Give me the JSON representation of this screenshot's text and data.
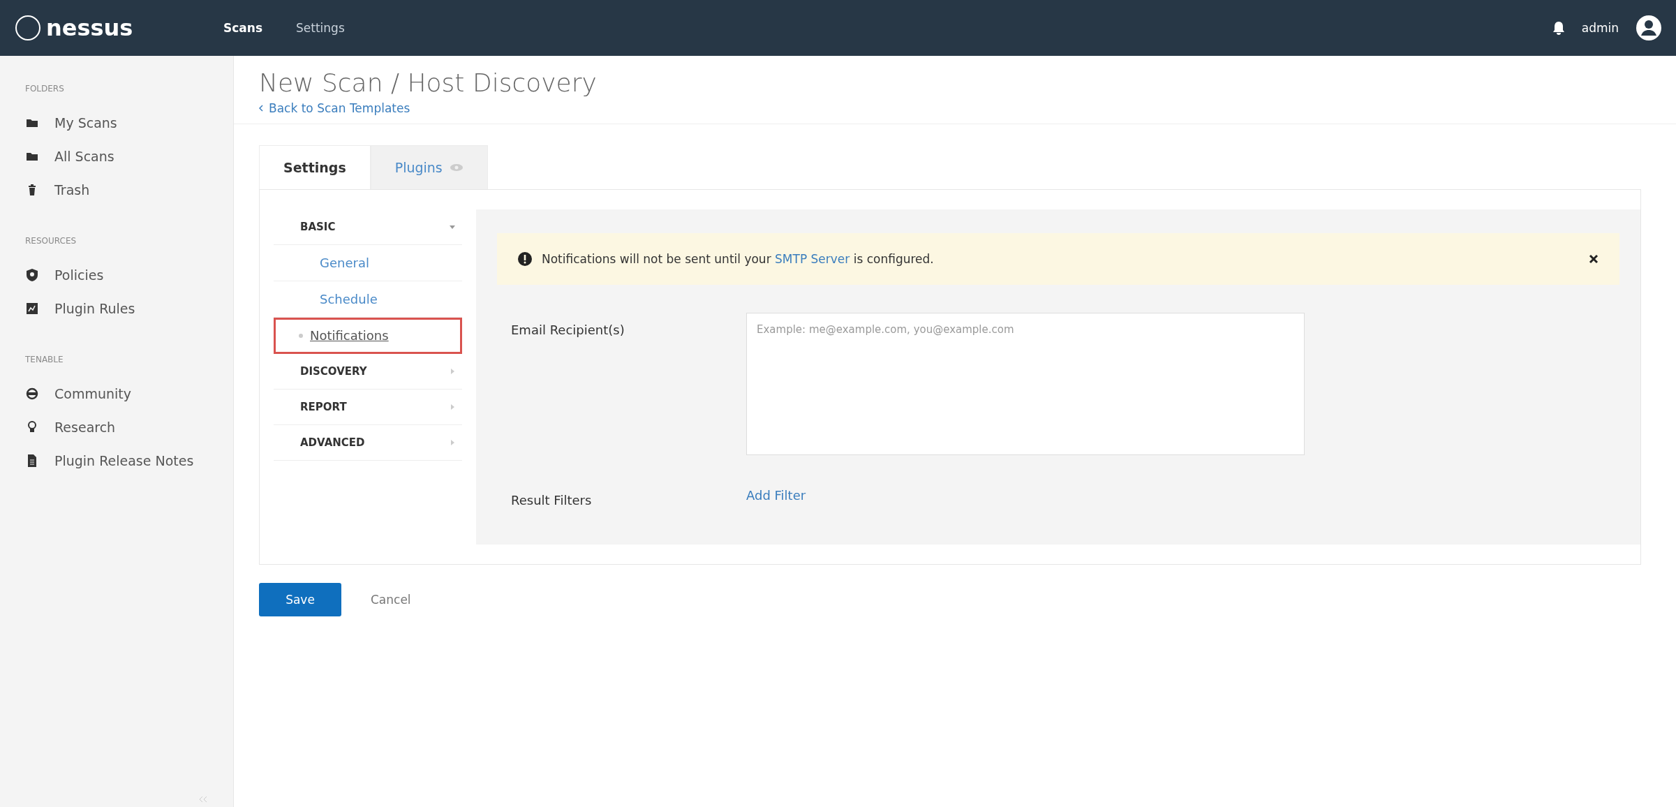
{
  "topbar": {
    "logo": "nessus",
    "nav": [
      {
        "label": "Scans",
        "selected": true
      },
      {
        "label": "Settings",
        "selected": false
      }
    ],
    "user": "admin"
  },
  "sidebar": {
    "sections": [
      {
        "title": "FOLDERS",
        "items": [
          {
            "label": "My Scans"
          },
          {
            "label": "All Scans"
          },
          {
            "label": "Trash"
          }
        ]
      },
      {
        "title": "RESOURCES",
        "items": [
          {
            "label": "Policies"
          },
          {
            "label": "Plugin Rules"
          }
        ]
      },
      {
        "title": "TENABLE",
        "items": [
          {
            "label": "Community"
          },
          {
            "label": "Research"
          },
          {
            "label": "Plugin Release Notes"
          }
        ]
      }
    ]
  },
  "page": {
    "title": "New Scan / Host Discovery",
    "back_link": "Back to Scan Templates"
  },
  "tabs": [
    {
      "label": "Settings",
      "selected": true
    },
    {
      "label": "Plugins",
      "selected": false
    }
  ],
  "menu": [
    {
      "label": "BASIC",
      "expanded": true,
      "children": [
        {
          "label": "General",
          "selected": false
        },
        {
          "label": "Schedule",
          "selected": false
        },
        {
          "label": "Notifications",
          "selected": true
        }
      ]
    },
    {
      "label": "DISCOVERY",
      "expanded": false
    },
    {
      "label": "REPORT",
      "expanded": false
    },
    {
      "label": "ADVANCED",
      "expanded": false
    }
  ],
  "alert": {
    "text_before": "Notifications will not be sent until your",
    "link": "SMTP Server",
    "text_after": "is configured."
  },
  "form": {
    "email_label": "Email Recipient(s)",
    "email_placeholder": "Example: me@example.com, you@example.com",
    "filters_label": "Result Filters",
    "add_filter": "Add Filter"
  },
  "buttons": {
    "save": "Save",
    "cancel": "Cancel"
  }
}
